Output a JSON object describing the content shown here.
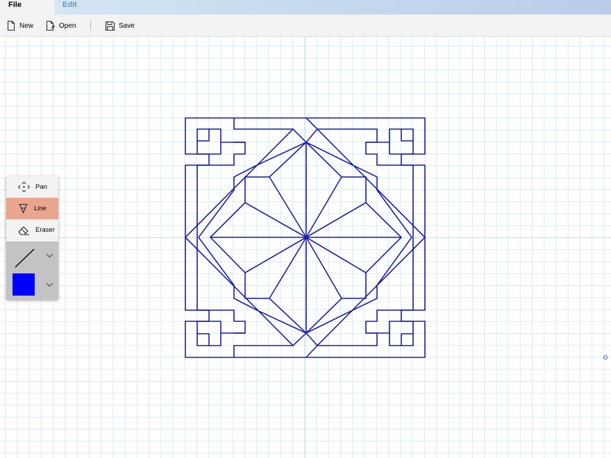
{
  "menu": {
    "file_label": "File",
    "edit_label": "Edit"
  },
  "toolbar": {
    "new_label": "New",
    "open_label": "Open",
    "save_label": "Save",
    "icons": [
      "new-file-icon",
      "open-file-icon",
      "save-icon"
    ]
  },
  "tools": {
    "pan_label": "Pan",
    "line_label": "Line",
    "eraser_label": "Eraser",
    "selected": "Line",
    "selected_highlight_color": "#eaa58f",
    "stroke_color": "#0000ff"
  },
  "canvas": {
    "grid_color": "#d6ecf6",
    "axis_color": "#bfe0f0",
    "drawing_color": "#1c1ca6"
  }
}
